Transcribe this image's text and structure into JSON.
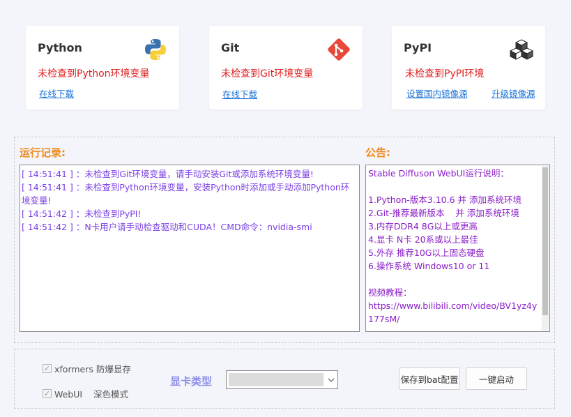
{
  "cards": {
    "python": {
      "title": "Python",
      "status": "未检查到Python环境变量",
      "link": "在线下载"
    },
    "git": {
      "title": "Git",
      "status": "未检查到Git环境变量",
      "link": "在线下载"
    },
    "pypi": {
      "title": "PyPI",
      "status": "未检查到PyPI环境",
      "link1": "设置国内镜像源",
      "link2": "升级镜像源"
    }
  },
  "log": {
    "label": "运行记录:",
    "lines": [
      "[ 14:51:41 ] ：未检查到Git环境变量，请手动安装Git或添加系统环境变量!",
      "[ 14:51:41 ] ：未检查到Python环境变量，安装Python时添加或手动添加Python环境变量!",
      "[ 14:51:42 ] ：未检查到PyPI!",
      "[ 14:51:42 ] ：N卡用户请手动检查驱动和CUDA！CMD命令：nvidia-smi"
    ]
  },
  "notice": {
    "label": "公告:",
    "lines": [
      "Stable Diffuson WebUI运行说明：",
      "",
      "1.Python-版本3.10.6 并 添加系统环境",
      "2.Git-推荐最新版本    并 添加系统环境",
      "3.内存DDR4 8G以上或更高",
      "4.显卡 N卡 20系或以上最佳",
      "5.外存 推荐10G以上固态硬盘",
      "6.操作系统 Windows10 or 11",
      "",
      "视频教程：",
      "https://www.bilibili.com/video/BV1yz4y177sM/"
    ]
  },
  "options": {
    "xformers_label": "xformers 防爆显存",
    "webui_label": "WebUI    深色模式",
    "gpu_label": "显卡类型",
    "gpu_selected": ""
  },
  "buttons": {
    "save": "保存到bat配置",
    "launch": "一键启动"
  },
  "colors": {
    "error": "#e01e1e",
    "link": "#1a73d9",
    "section": "#ef8a1c",
    "log_text": "#7a3fe6",
    "notice_text": "#8a1ec8",
    "gpu_label": "#8a8ee8"
  }
}
